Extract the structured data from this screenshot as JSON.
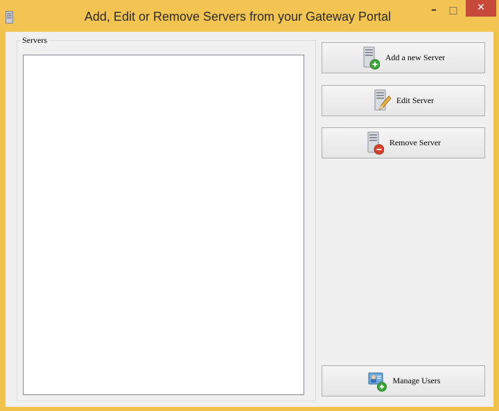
{
  "window": {
    "title": "Add, Edit or Remove Servers from your Gateway Portal",
    "minimize_label": "–",
    "maximize_label": "□",
    "close_label": "✕"
  },
  "servers_group": {
    "label": "Servers",
    "items": []
  },
  "buttons": {
    "add": "Add a new Server",
    "edit": "Edit Server",
    "remove": "Remove Server",
    "manage_users": "Manage Users"
  },
  "colors": {
    "titlebar": "#f4c452",
    "close_button": "#c7493b",
    "client_background": "#f0f0f0",
    "add_badge": "#3ea83a",
    "remove_badge": "#d9412b"
  }
}
